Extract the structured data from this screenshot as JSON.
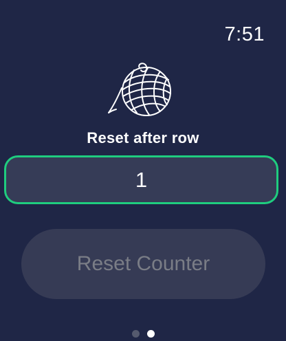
{
  "status_bar": {
    "time": "7:51"
  },
  "header": {
    "icon": "yarn-ball-icon"
  },
  "reset_setting": {
    "label": "Reset after row",
    "value": "1"
  },
  "actions": {
    "reset_label": "Reset Counter"
  },
  "pagination": {
    "total_pages": 2,
    "current_page": 2
  },
  "colors": {
    "background": "#1f2646",
    "accent": "#1fcd7f",
    "field": "#363c57",
    "disabled_text": "#7a7d86"
  }
}
